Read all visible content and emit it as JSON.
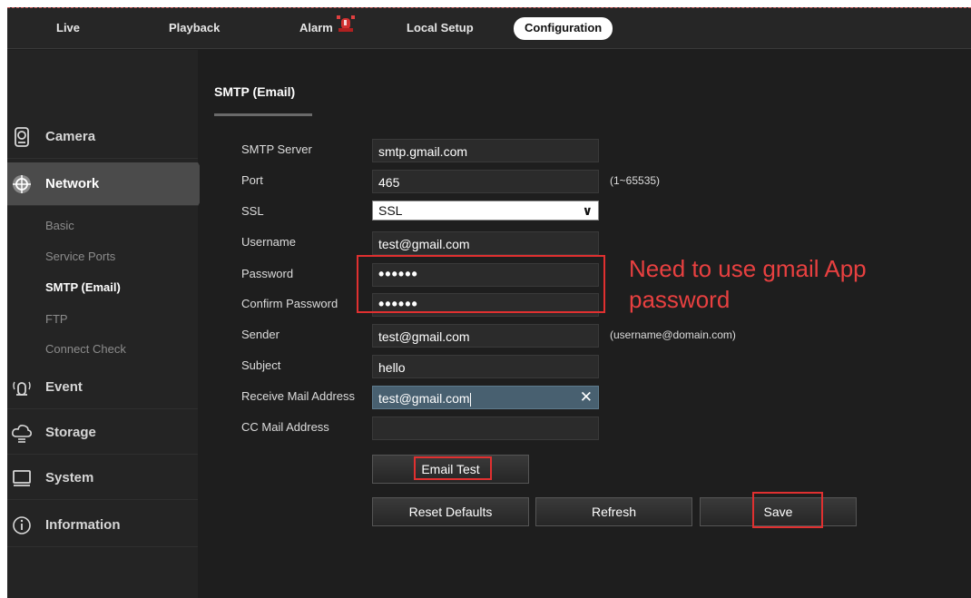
{
  "topnav": {
    "tabs": [
      {
        "label": "Live"
      },
      {
        "label": "Playback"
      },
      {
        "label": "Alarm"
      },
      {
        "label": "Local Setup"
      },
      {
        "label": "Configuration"
      }
    ],
    "active": "Configuration"
  },
  "sidebar": {
    "sections": [
      {
        "label": "Camera",
        "icon": "camera-icon"
      },
      {
        "label": "Network",
        "icon": "network-icon"
      },
      {
        "label": "Event",
        "icon": "event-icon"
      },
      {
        "label": "Storage",
        "icon": "storage-icon"
      },
      {
        "label": "System",
        "icon": "system-icon"
      },
      {
        "label": "Information",
        "icon": "information-icon"
      }
    ],
    "network_subitems": [
      {
        "label": "Basic"
      },
      {
        "label": "Service Ports"
      },
      {
        "label": "SMTP (Email)"
      },
      {
        "label": "FTP"
      },
      {
        "label": "Connect Check"
      }
    ],
    "active_section": "Network",
    "active_subitem": "SMTP (Email)"
  },
  "main": {
    "title": "SMTP (Email)",
    "fields": {
      "smtp_server": {
        "label": "SMTP Server",
        "value": "smtp.gmail.com"
      },
      "port": {
        "label": "Port",
        "value": "465",
        "hint": "(1~65535)"
      },
      "ssl": {
        "label": "SSL",
        "value": "SSL"
      },
      "username": {
        "label": "Username",
        "value": "test@gmail.com"
      },
      "password": {
        "label": "Password",
        "value": "••••••"
      },
      "confirm_password": {
        "label": "Confirm Password",
        "value": "••••••"
      },
      "sender": {
        "label": "Sender",
        "value": "test@gmail.com",
        "hint": "(username@domain.com)"
      },
      "subject": {
        "label": "Subject",
        "value": "hello"
      },
      "receive_mail": {
        "label": "Receive Mail Address",
        "value": "test@gmail.com"
      },
      "cc_mail": {
        "label": "CC Mail Address",
        "value": ""
      }
    },
    "buttons": {
      "email_test": "Email Test",
      "reset_defaults": "Reset Defaults",
      "refresh": "Refresh",
      "save": "Save"
    },
    "annotation": {
      "line1": "Need to use gmail App",
      "line2": "password"
    }
  },
  "colors": {
    "annotation": "#e84040",
    "background": "#1e1e1e",
    "sidebar_active": "#4b4b4b",
    "highlight_field": "#486070"
  }
}
